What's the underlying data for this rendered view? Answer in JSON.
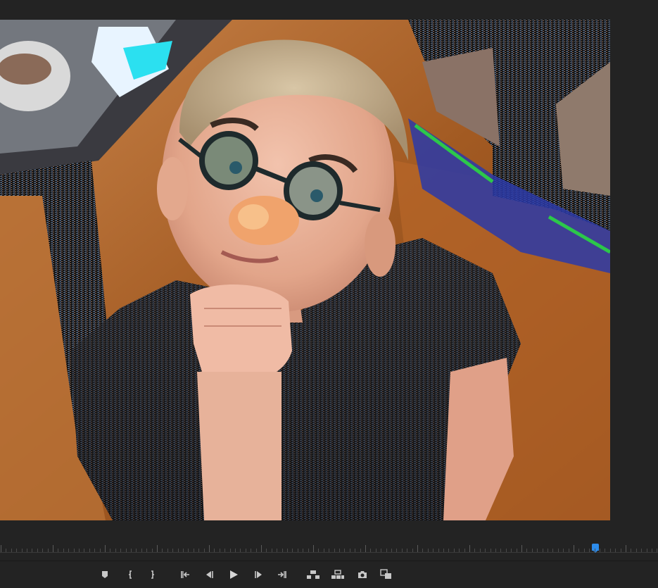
{
  "monitor": {
    "background": "#232323",
    "frame_description_icon": "video-frame",
    "playhead_color": "#2d8ceb",
    "playhead_position": 0.9
  },
  "transport": {
    "buttons": [
      {
        "name": "add-marker-button",
        "icon": "marker-icon"
      },
      {
        "name": "mark-in-button",
        "icon": "mark-in-icon"
      },
      {
        "name": "mark-out-button",
        "icon": "mark-out-icon"
      },
      {
        "name": "go-to-in-button",
        "icon": "go-to-in-icon"
      },
      {
        "name": "step-back-button",
        "icon": "step-back-icon"
      },
      {
        "name": "play-button",
        "icon": "play-icon"
      },
      {
        "name": "step-forward-button",
        "icon": "step-forward-icon"
      },
      {
        "name": "go-to-out-button",
        "icon": "go-to-out-icon"
      },
      {
        "name": "lift-button",
        "icon": "lift-icon"
      },
      {
        "name": "extract-button",
        "icon": "extract-icon"
      },
      {
        "name": "export-frame-button",
        "icon": "camera-icon"
      },
      {
        "name": "compare-view-button",
        "icon": "compare-icon"
      }
    ],
    "icon_color": "#c8c8c8"
  }
}
